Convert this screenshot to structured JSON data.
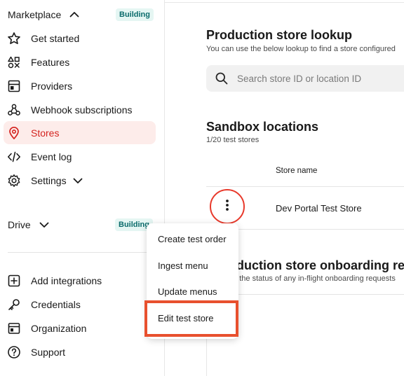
{
  "sidebar": {
    "marketplace": {
      "label": "Marketplace",
      "badge": "Building"
    },
    "items": [
      {
        "label": "Get started",
        "icon": "star-icon"
      },
      {
        "label": "Features",
        "icon": "shapes-icon"
      },
      {
        "label": "Providers",
        "icon": "layout-icon"
      },
      {
        "label": "Webhook subscriptions",
        "icon": "webhook-icon"
      },
      {
        "label": "Stores",
        "icon": "location-pin-icon",
        "active": true
      },
      {
        "label": "Event log",
        "icon": "code-icon"
      },
      {
        "label": "Settings",
        "icon": "gear-icon"
      }
    ],
    "drive": {
      "label": "Drive",
      "badge": "Building"
    },
    "bottom_items": [
      {
        "label": "Add integrations",
        "icon": "plus-square-icon"
      },
      {
        "label": "Credentials",
        "icon": "key-icon"
      },
      {
        "label": "Organization",
        "icon": "building-icon"
      },
      {
        "label": "Support",
        "icon": "help-circle-icon"
      }
    ]
  },
  "main": {
    "lookup": {
      "title": "Production store lookup",
      "subtitle": "You can use the below lookup to find a store configured",
      "search_placeholder": "Search store ID or location ID"
    },
    "sandbox": {
      "title": "Sandbox locations",
      "count": "1/20 test stores",
      "column_header": "Store name",
      "rows": [
        {
          "name": "Dev Portal Test Store"
        }
      ]
    },
    "onboarding": {
      "title": "Production store onboarding requests",
      "subtitle": "Check the status of any in-flight onboarding requests"
    }
  },
  "context_menu": {
    "items": [
      "Create test order",
      "Ingest menu",
      "Update menus",
      "Edit test store"
    ]
  },
  "colors": {
    "accent": "#d4231f",
    "active_bg": "#fdecea",
    "badge_bg": "#e5f6f3",
    "badge_text": "#0a6b6b",
    "highlight": "#e8502e"
  }
}
